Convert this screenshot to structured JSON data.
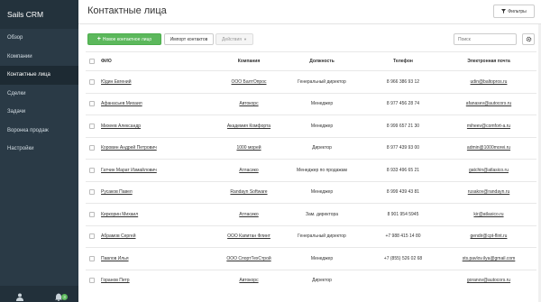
{
  "sidebar": {
    "brand": "Sails CRM",
    "items": [
      {
        "label": "Обзор",
        "active": false
      },
      {
        "label": "Компании",
        "active": false
      },
      {
        "label": "Контактные лица",
        "active": true
      },
      {
        "label": "Сделки",
        "active": false
      },
      {
        "label": "Задачи",
        "active": false
      },
      {
        "label": "Воронка продаж",
        "active": false
      },
      {
        "label": "Настройки",
        "active": false
      }
    ],
    "footer": {
      "user_icon": "user-icon",
      "bell_icon": "bell-icon",
      "notifications_badge": "3"
    }
  },
  "header": {
    "title": "Контактные лица",
    "filter_button": "Фильтры"
  },
  "toolbar": {
    "add_button": "Новое контактное лицо",
    "import_button": "Импорт контактов",
    "actions_button": "Действия",
    "search_placeholder": "Поиск"
  },
  "table": {
    "columns": [
      "ФИО",
      "Компания",
      "Должность",
      "Телефон",
      "Электронная почта"
    ],
    "rows": [
      {
        "name": "Юдин Евгений",
        "company": "ООО БалтОпрос",
        "position": "Генеральный директор",
        "phone": "8 966 386 93 12",
        "email": "udin@baltopros.ru"
      },
      {
        "name": "Афанасьев Михаил",
        "company": "Автокорс",
        "position": "Менеджер",
        "phone": "8 977 456 28 74",
        "email": "afanasev@autocors.ru"
      },
      {
        "name": "Михеев Александр",
        "company": "Академия Комфорта",
        "position": "Менеджер",
        "phone": "8 999 657 21 30",
        "email": "miheev@comfort-a.ru"
      },
      {
        "name": "Коровин Андрей Петрович",
        "company": "1000 морей",
        "position": "Директор",
        "phone": "8 977 439 93 00",
        "email": "admin@1000morei.ru"
      },
      {
        "name": "Гатчин Марат Измайлович",
        "company": "Атласико",
        "position": "Менеджер по продажам",
        "phone": "8 933 496 65 21",
        "email": "gatchin@atlasico.ru"
      },
      {
        "name": "Русаков Павел",
        "company": "Randayn Software",
        "position": "Менеджер",
        "phone": "8 999 439 43 81",
        "email": "rusakov@randayn.ru"
      },
      {
        "name": "Киркорин Михаил",
        "company": "Атласико",
        "position": "Зам. директора",
        "phone": "8 901 954 5945",
        "email": "kir@atlasico.ru"
      },
      {
        "name": "Абрамов Сергей",
        "company": "ООО Капитан Флинт",
        "position": "Генеральный директор",
        "phone": "+7 988 415 14 80",
        "email": "gendir@cpt-flint.ru"
      },
      {
        "name": "Павлов Илья",
        "company": "ООО СпортТехСтрой",
        "position": "Менеджер",
        "phone": "+7 (855) 526 02 68",
        "email": "sts.pavlov.ilya@gmail.com"
      },
      {
        "name": "Горанов Петр",
        "company": "Автокорс",
        "position": "Директор",
        "phone": "",
        "email": "goranov@autocors.ru"
      }
    ]
  }
}
